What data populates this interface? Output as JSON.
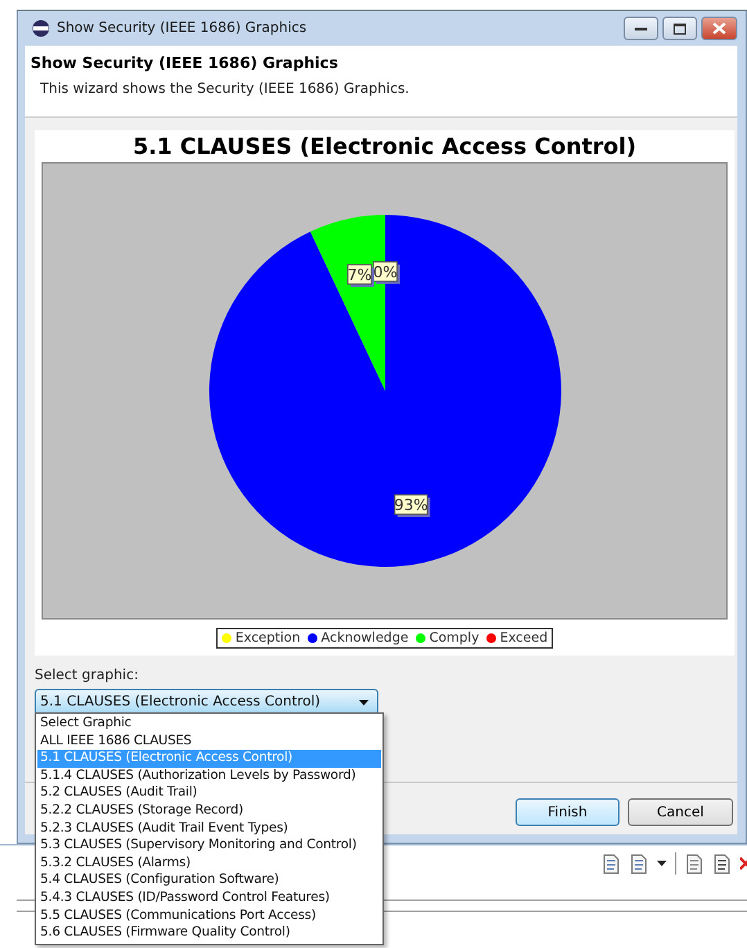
{
  "window": {
    "title": "Show Security (IEEE 1686) Graphics"
  },
  "header": {
    "title": "Show Security (IEEE 1686) Graphics",
    "description": "This wizard shows the Security (IEEE 1686) Graphics."
  },
  "chart": {
    "chart_data": {
      "type": "pie",
      "title": "5.1 CLAUSES (Electronic Access Control)",
      "categories": [
        "Exception",
        "Acknowledge",
        "Comply",
        "Exceed"
      ],
      "values": [
        0,
        93,
        7,
        0
      ],
      "colors": [
        "#ffff00",
        "#0000ff",
        "#00ff00",
        "#ff0000"
      ],
      "value_labels": [
        "0%",
        "93%",
        "7%",
        null
      ],
      "legend": true
    }
  },
  "select": {
    "label": "Select graphic:",
    "value": "5.1 CLAUSES (Electronic Access Control)",
    "expanded": true,
    "options": [
      {
        "label": "Select Graphic",
        "selected": false
      },
      {
        "label": "ALL IEEE 1686 CLAUSES",
        "selected": false
      },
      {
        "label": "5.1 CLAUSES (Electronic Access Control)",
        "selected": true
      },
      {
        "label": "5.1.4 CLAUSES (Authorization Levels by Password)",
        "selected": false
      },
      {
        "label": "5.2 CLAUSES (Audit Trail)",
        "selected": false
      },
      {
        "label": "5.2.2 CLAUSES (Storage Record)",
        "selected": false
      },
      {
        "label": "5.2.3 CLAUSES (Audit Trail Event Types)",
        "selected": false
      },
      {
        "label": "5.3 CLAUSES (Supervisory Monitoring and Control)",
        "selected": false
      },
      {
        "label": "5.3.2 CLAUSES (Alarms)",
        "selected": false
      },
      {
        "label": "5.4 CLAUSES (Configuration Software)",
        "selected": false
      },
      {
        "label": "5.4.3 CLAUSES (ID/Password Control Features)",
        "selected": false
      },
      {
        "label": "5.5 CLAUSES (Communications Port Access)",
        "selected": false
      },
      {
        "label": "5.6 CLAUSES (Firmware Quality Control)",
        "selected": false
      }
    ]
  },
  "buttons": [
    {
      "label": "Finish",
      "default": true
    },
    {
      "label": "Cancel",
      "default": false
    }
  ]
}
